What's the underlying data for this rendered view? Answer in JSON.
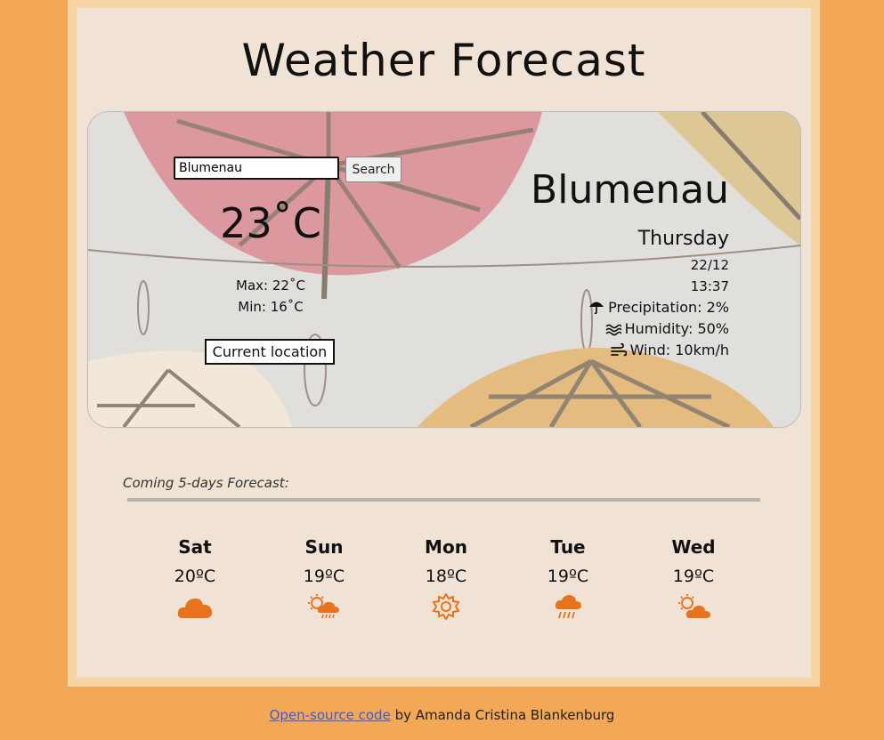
{
  "page": {
    "title": "Weather Forecast"
  },
  "search": {
    "value": "Blumenau",
    "button_label": "Search"
  },
  "current": {
    "temperature": "23˚C",
    "max": "Max: 22˚C",
    "min": "Min: 16˚C",
    "location_button": "Current location",
    "city": "Blumenau",
    "day": "Thursday",
    "date": "22/12",
    "time": "13:37",
    "precipitation": "Precipitation: 2%",
    "humidity": "Humidity: 50%",
    "wind": "Wind: 10km/h",
    "icons": [
      "umbrella-icon",
      "humidity-waves-icon",
      "wind-icon"
    ]
  },
  "forecast": {
    "heading": "Coming 5-days Forecast:",
    "days": [
      {
        "name": "Sat",
        "temp": "20ºC",
        "icon": "cloud-icon"
      },
      {
        "name": "Sun",
        "temp": "19ºC",
        "icon": "sun-cloud-rain-icon"
      },
      {
        "name": "Mon",
        "temp": "18ºC",
        "icon": "sun-icon"
      },
      {
        "name": "Tue",
        "temp": "19ºC",
        "icon": "cloud-rain-icon"
      },
      {
        "name": "Wed",
        "temp": "19ºC",
        "icon": "sun-cloud-icon"
      }
    ],
    "icon_color": "#e8731c"
  },
  "footer": {
    "link_text": "Open-source code",
    "text": " by Amanda Cristina Blankenburg"
  },
  "colors": {
    "page_bg": "#f2a857",
    "frame": "#f6d4a4",
    "panel": "#f0e3d6",
    "link": "#3b5bdb"
  }
}
